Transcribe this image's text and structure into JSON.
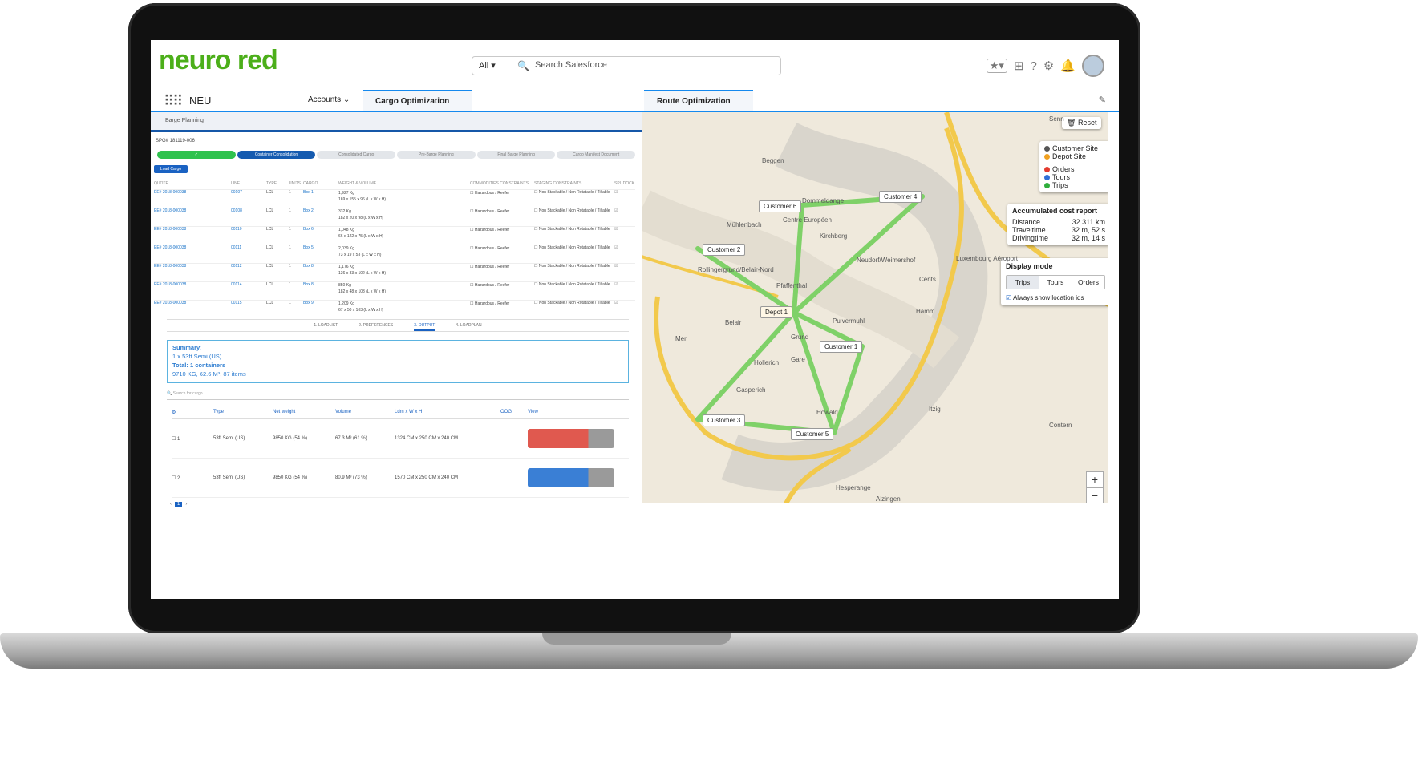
{
  "app": {
    "logo": "neuro red",
    "name": "NEU"
  },
  "header": {
    "search_scope": "All",
    "search_placeholder": "Search Salesforce"
  },
  "nav": {
    "tabs": [
      {
        "label": "Accounts"
      },
      {
        "label": "Cargo Optimization"
      },
      {
        "label": "Route Optimization"
      }
    ]
  },
  "cargo": {
    "panel_title": "Barge Planning",
    "spg": "SPG# 181119-006",
    "steps": [
      "✓",
      "Container Consolidation",
      "Consolidated Cargo",
      "Pre-Barge Planning",
      "Final Barge Planning",
      "Cargo Manifest Document"
    ],
    "load_button": "Load Cargo",
    "table_headers": [
      "QUOTE",
      "LINE",
      "TYPE",
      "UNITS",
      "CARGO",
      "WEIGHT & VOLUME",
      "COMMODITIES CONSTRAINTS",
      "STAGING CONSTRAINTS",
      "SPL DOCK"
    ],
    "rows": [
      {
        "quote": "EE# 2018-000038",
        "line": "00107",
        "type": "LCL",
        "units": "1",
        "cargo": "Box 1",
        "weight": "1,927 Kg",
        "dims": "169 x 155 x 96 (L x W x H)",
        "commodities": "Hazardous / Reefer",
        "staging": "Non Stackable / Non Rotatable / Tiltable"
      },
      {
        "quote": "EE# 2018-000038",
        "line": "00108",
        "type": "LCL",
        "units": "1",
        "cargo": "Box 2",
        "weight": "332 Kg",
        "dims": "182 x 20 x 98 (L x W x H)",
        "commodities": "Hazardous / Reefer",
        "staging": "Non Stackable / Non Rotatable / Tiltable"
      },
      {
        "quote": "EE# 2018-000038",
        "line": "00110",
        "type": "LCL",
        "units": "1",
        "cargo": "Box 6",
        "weight": "1,048 Kg",
        "dims": "66 x 122 x 75 (L x W x H)",
        "commodities": "Hazardous / Reefer",
        "staging": "Non Stackable / Non Rotatable / Tiltable"
      },
      {
        "quote": "EE# 2018-000038",
        "line": "00111",
        "type": "LCL",
        "units": "1",
        "cargo": "Box 5",
        "weight": "2,039 Kg",
        "dims": "73 x 19 x 53 (L x W x H)",
        "commodities": "Hazardous / Reefer",
        "staging": "Non Stackable / Non Rotatable / Tiltable"
      },
      {
        "quote": "EE# 2018-000038",
        "line": "00112",
        "type": "LCL",
        "units": "1",
        "cargo": "Box 8",
        "weight": "1,176 Kg",
        "dims": "136 x 33 x 102 (L x W x H)",
        "commodities": "Hazardous / Reefer",
        "staging": "Non Stackable / Non Rotatable / Tiltable"
      },
      {
        "quote": "EE# 2018-000038",
        "line": "00114",
        "type": "LCL",
        "units": "1",
        "cargo": "Box 8",
        "weight": "850 Kg",
        "dims": "182 x 48 x 103 (L x W x H)",
        "commodities": "Hazardous / Reefer",
        "staging": "Non Stackable / Non Rotatable / Tiltable"
      },
      {
        "quote": "EE# 2018-000038",
        "line": "00115",
        "type": "LCL",
        "units": "1",
        "cargo": "Box 9",
        "weight": "1,209 Kg",
        "dims": "67 x 50 x 103 (L x W x H)",
        "commodities": "Hazardous / Reefer",
        "staging": "Non Stackable / Non Rotatable / Tiltable"
      }
    ],
    "output_tabs": [
      "1. LOADLIST",
      "2. PREFERENCES",
      "3. OUTPUT",
      "4. LOADPLAN"
    ],
    "summary": {
      "label": "Summary:",
      "line1": "1 x 53ft Semi (US)",
      "total": "Total: 1 containers",
      "line2": "9710 KG, 62.6 M³, 87 items"
    },
    "search_placeholder": "Search for cargo",
    "result_headers": [
      "Type",
      "Net weight",
      "Volume",
      "Ldm x W x H",
      "OOG",
      "View"
    ],
    "results": [
      {
        "num": "1",
        "type": "53ft Semi (US)",
        "net": "9850 KG (54 %)",
        "volume": "67.3 M³ (61 %)",
        "dims": "1324 CM x 250 CM x 240 CM",
        "view_color": "#e0594f"
      },
      {
        "num": "2",
        "type": "53ft Semi (US)",
        "net": "9850 KG (54 %)",
        "volume": "80.9 M³ (73 %)",
        "dims": "1570 CM x 250 CM x 240 CM",
        "view_color": "#3a7fd5"
      }
    ],
    "pager": {
      "prev": "‹",
      "page": "1",
      "next": "›"
    }
  },
  "route": {
    "reset": "Reset",
    "legend": [
      {
        "label": "Customer Site",
        "color": "#555555"
      },
      {
        "label": "Depot Site",
        "color": "#f0a020"
      },
      {
        "label": "Orders",
        "color": "#e33b2e"
      },
      {
        "label": "Tours",
        "color": "#2f6fd6"
      },
      {
        "label": "Trips",
        "color": "#2fae3c"
      }
    ],
    "cost": {
      "title": "Accumulated cost report",
      "rows": [
        {
          "k": "Distance",
          "v": "32.311 km"
        },
        {
          "k": "Traveltime",
          "v": "32 m, 52 s"
        },
        {
          "k": "Drivingtime",
          "v": "32 m, 14 s"
        }
      ]
    },
    "display": {
      "title": "Display mode",
      "modes": [
        "Trips",
        "Tours",
        "Orders"
      ],
      "checkbox": "Always show location ids"
    },
    "locations": [
      {
        "label": "Customer 6"
      },
      {
        "label": "Customer 4"
      },
      {
        "label": "Customer 2"
      },
      {
        "label": "Depot 1"
      },
      {
        "label": "Customer 1"
      },
      {
        "label": "Customer 3"
      },
      {
        "label": "Customer 5"
      }
    ],
    "places": [
      "Beggen",
      "Mühlenbach",
      "Centre Européen",
      "Kirchberg",
      "Rollingergrund/Belair-Nord",
      "Pfaffenthal",
      "Neudorf/Weimershof",
      "Cents",
      "Belair",
      "Grund",
      "Pulvermuhl",
      "Hamm",
      "Merl",
      "Gare",
      "Hollerich",
      "Gasperich",
      "Howald",
      "Itzig",
      "Contern",
      "Hesperange",
      "Alzingen",
      "Luxembourg Aéroport",
      "Senn",
      "Dommeldange"
    ],
    "zoom_in": "+",
    "zoom_out": "−"
  }
}
